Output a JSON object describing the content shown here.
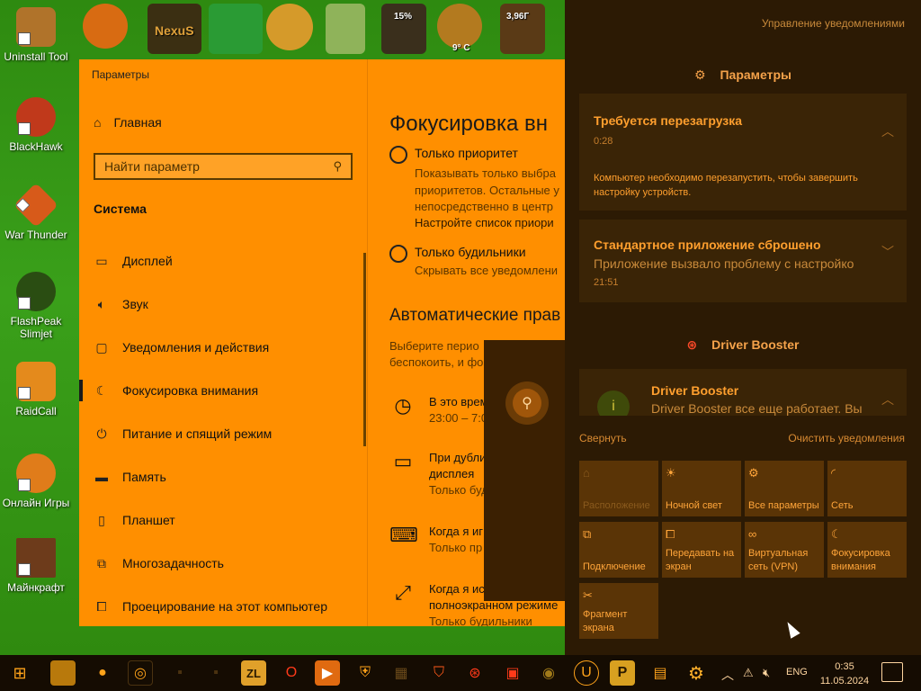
{
  "desktop": {
    "icons": [
      {
        "label": "Uninstall Tool",
        "color": "#b0732a"
      },
      {
        "label": "BlackHawk",
        "color": "#c0391b"
      },
      {
        "label": "War Thunder",
        "color": "#d75a1a"
      },
      {
        "label": "FlashPeak Slimjet",
        "color": "#2a4d12"
      },
      {
        "label": "RaidCall",
        "color": "#e48a1c"
      },
      {
        "label": "Онлайн Игры",
        "color": "#e07c1a"
      },
      {
        "label": "Майнкрафт",
        "color": "#6d3b1b"
      }
    ],
    "top_icons": [
      {
        "name": "radiation-gadget",
        "color": "#d86b12"
      },
      {
        "name": "nexus-gadget",
        "color": "#3b2f12"
      },
      {
        "name": "windows-gadget",
        "color": "#2a9b34"
      },
      {
        "name": "clock-gadget",
        "color": "#d59a2a"
      },
      {
        "name": "recycle-bin",
        "color": "#8fb35a"
      },
      {
        "name": "cpu-gadget",
        "color": "#3a2f1c"
      },
      {
        "name": "weather-gadget",
        "color": "#b37a1f"
      },
      {
        "name": "ram-gadget",
        "color": "#5a3a16"
      }
    ],
    "cpu_percent": "15%",
    "temperature": "9° C",
    "ram_amount": "3,96Г"
  },
  "settings": {
    "window_title": "Параметры",
    "home_label": "Главная",
    "search_placeholder": "Найти параметр",
    "section_title": "Система",
    "nav_items": [
      {
        "label": "Дисплей",
        "icon": "display-icon"
      },
      {
        "label": "Звук",
        "icon": "sound-icon"
      },
      {
        "label": "Уведомления и действия",
        "icon": "notifications-icon"
      },
      {
        "label": "Фокусировка внимания",
        "icon": "moon-icon"
      },
      {
        "label": "Питание и спящий режим",
        "icon": "power-icon"
      },
      {
        "label": "Память",
        "icon": "storage-icon"
      },
      {
        "label": "Планшет",
        "icon": "tablet-icon"
      },
      {
        "label": "Многозадачность",
        "icon": "multitask-icon"
      },
      {
        "label": "Проецирование на этот компьютер",
        "icon": "project-icon"
      }
    ],
    "page_title": "Фокусировка вн",
    "priority_label": "Только приоритет",
    "priority_desc": [
      "Показывать только выбра",
      "приоритетов. Остальные у",
      "непосредственно в центр"
    ],
    "priority_link": "Настройте список приори",
    "alarms_label": "Только будильники",
    "alarms_desc": "Скрывать все уведомлени",
    "auto_rules_title": "Автоматические прав",
    "auto_rules_desc": [
      "Выберите перио",
      "беспокоить, и фо"
    ],
    "rules": [
      {
        "icon": "clock-icon",
        "lines": [
          "В это врем",
          "23:00 – 7:0"
        ]
      },
      {
        "icon": "monitor-icon",
        "lines": [
          "При дубли",
          "дисплея",
          "Только буд"
        ]
      },
      {
        "icon": "gamepad-icon",
        "lines": [
          "Когда я иг",
          "Только пр"
        ]
      },
      {
        "icon": "fullscreen-icon",
        "lines": [
          "Когда я ис",
          "полноэкранном режиме",
          "Только будильники"
        ]
      }
    ]
  },
  "action_center": {
    "manage_label": "Управление уведомлениями",
    "settings_header": "Параметры",
    "notifications": [
      {
        "title": "Требуется перезагрузка",
        "time": "0:28",
        "body": [
          "Компьютер необходимо перезапустить, чтобы завершить",
          "настройку устройств."
        ]
      },
      {
        "title": "Стандартное приложение сброшено",
        "subtitle": "Приложение вызвало проблему с настройко",
        "time": "21:51"
      }
    ],
    "driver_booster_header": "Driver Booster",
    "driver_booster_title": "Driver Booster",
    "driver_booster_body": "Driver Booster все еще работает. Вы",
    "collapse_label": "Свернуть",
    "clear_label": "Очистить уведомления",
    "quick_actions": [
      {
        "label": "Расположение",
        "icon": "location-icon",
        "dim": true
      },
      {
        "label": "Ночной свет",
        "icon": "sun-icon"
      },
      {
        "label": "Все параметры",
        "icon": "gear-icon"
      },
      {
        "label": "Сеть",
        "icon": "network-icon"
      },
      {
        "label": "Подключение",
        "icon": "connect-icon"
      },
      {
        "label": "Передавать на экран",
        "icon": "project-icon"
      },
      {
        "label": "Виртуальная сеть (VPN)",
        "icon": "vpn-icon"
      },
      {
        "label": "Фокусировка внимания",
        "icon": "moon-icon"
      },
      {
        "label": "Фрагмент экрана",
        "icon": "snip-icon"
      }
    ]
  },
  "taskbar": {
    "language": "ENG",
    "time": "0:35",
    "date": "11.05.2024"
  }
}
